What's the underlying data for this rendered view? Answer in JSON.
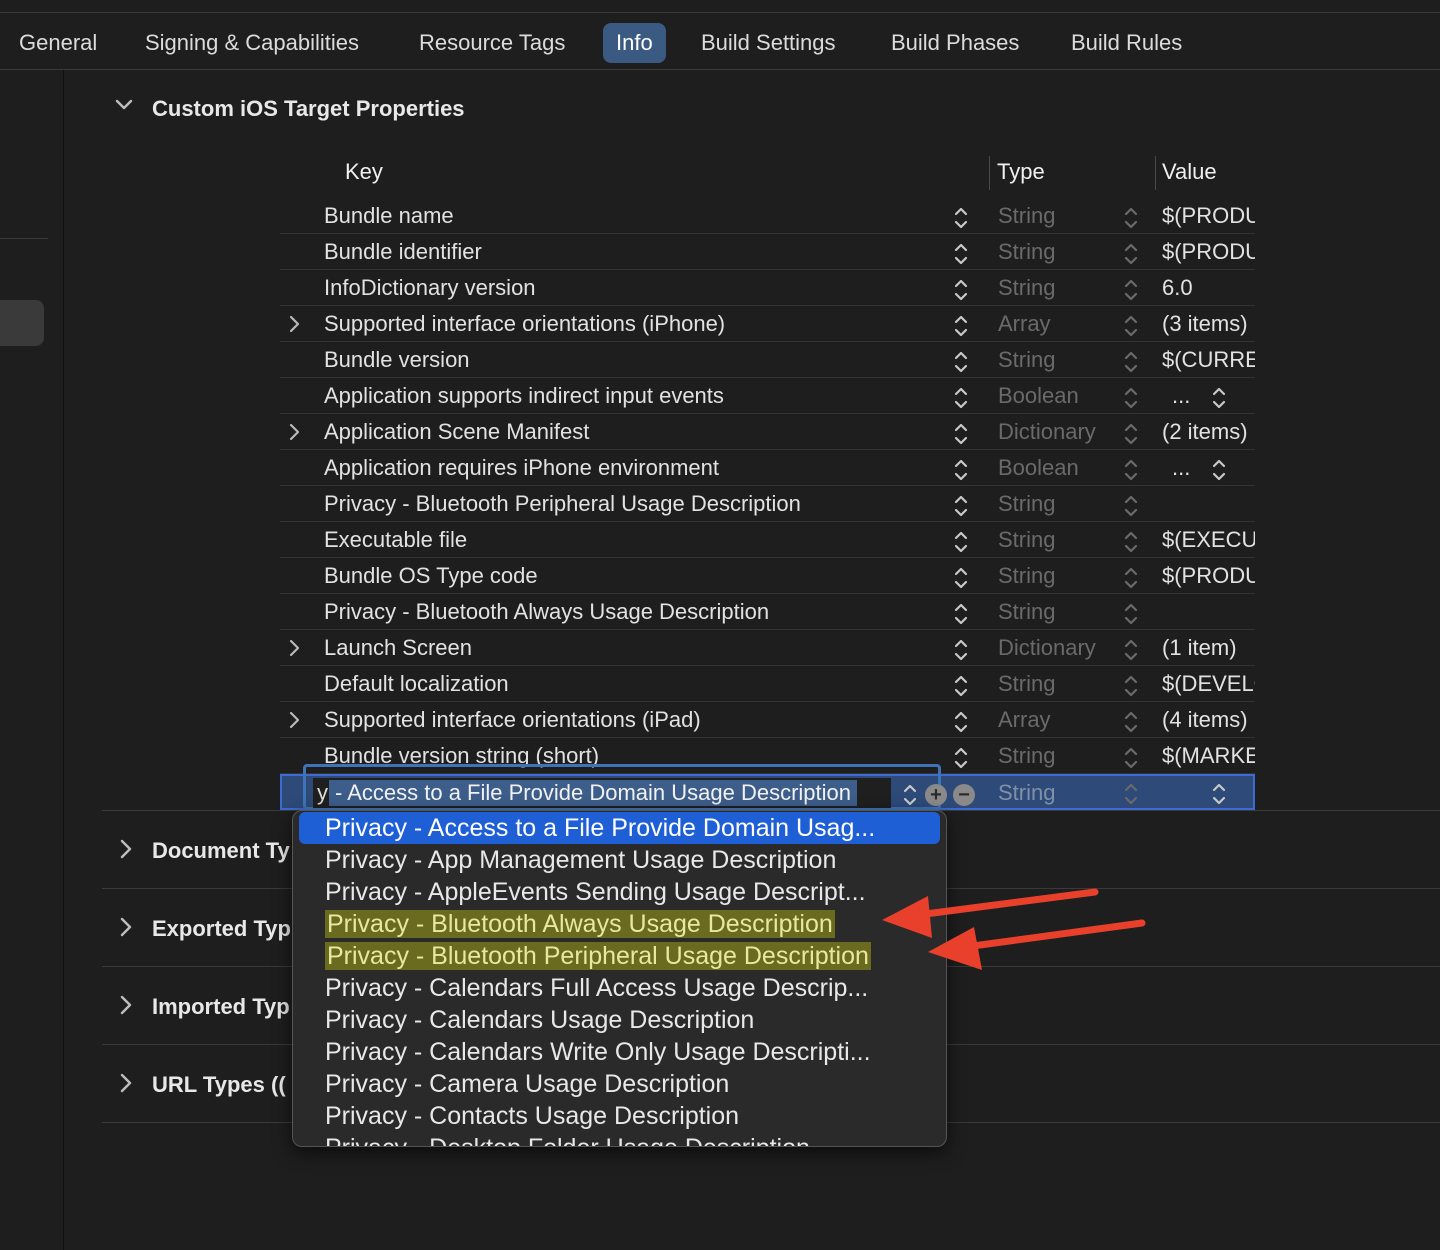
{
  "tabs": [
    {
      "label": "General"
    },
    {
      "label": "Signing & Capabilities"
    },
    {
      "label": "Resource Tags"
    },
    {
      "label": "Info"
    },
    {
      "label": "Build Settings"
    },
    {
      "label": "Build Phases"
    },
    {
      "label": "Build Rules"
    }
  ],
  "section": {
    "title": "Custom iOS Target Properties"
  },
  "columns": {
    "key": "Key",
    "type": "Type",
    "value": "Value"
  },
  "rows": [
    {
      "key": "Bundle name",
      "type": "String",
      "value": "$(PRODUCT_NAME)",
      "expandable": false
    },
    {
      "key": "Bundle identifier",
      "type": "String",
      "value": "$(PRODUCT_BUNDLE_IDENTIFIER)",
      "expandable": false
    },
    {
      "key": "InfoDictionary version",
      "type": "String",
      "value": "6.0",
      "expandable": false
    },
    {
      "key": "Supported interface orientations (iPhone)",
      "type": "Array",
      "value": "(3 items)",
      "expandable": true
    },
    {
      "key": "Bundle version",
      "type": "String",
      "value": "$(CURRENT_PROJECT_VERSION)",
      "expandable": false
    },
    {
      "key": "Application supports indirect input events",
      "type": "Boolean",
      "value": "...",
      "expandable": false
    },
    {
      "key": "Application Scene Manifest",
      "type": "Dictionary",
      "value": "(2 items)",
      "expandable": true
    },
    {
      "key": "Application requires iPhone environment",
      "type": "Boolean",
      "value": "...",
      "expandable": false
    },
    {
      "key": "Privacy - Bluetooth Peripheral Usage Description",
      "type": "String",
      "value": "",
      "expandable": false
    },
    {
      "key": "Executable file",
      "type": "String",
      "value": "$(EXECUTABLE_NAME)",
      "expandable": false
    },
    {
      "key": "Bundle OS Type code",
      "type": "String",
      "value": "$(PRODUCT_BUNDLE_PACKAGE_TYPE)",
      "expandable": false
    },
    {
      "key": "Privacy - Bluetooth Always Usage Description",
      "type": "String",
      "value": "",
      "expandable": false
    },
    {
      "key": "Launch Screen",
      "type": "Dictionary",
      "value": "(1 item)",
      "expandable": true
    },
    {
      "key": "Default localization",
      "type": "String",
      "value": "$(DEVELOPMENT_LANGUAGE)",
      "expandable": false
    },
    {
      "key": "Supported interface orientations (iPad)",
      "type": "Array",
      "value": "(4 items)",
      "expandable": true
    },
    {
      "key": "Bundle version string (short)",
      "type": "String",
      "value": "$(MARKETING_VERSION)",
      "expandable": false
    }
  ],
  "edit_row": {
    "caret_text": "y",
    "selected_text": "- Access to a File Provide Domain Usage Description",
    "type": "String",
    "add_symbol": "+",
    "remove_symbol": "−"
  },
  "collapsed_sections": [
    {
      "title": "Document Ty"
    },
    {
      "title": "Exported Typ"
    },
    {
      "title": "Imported Typ"
    },
    {
      "title": "URL Types (("
    }
  ],
  "dropdown": {
    "items": [
      {
        "label": "Privacy - Access to a File Provide Domain Usag...",
        "state": "selected"
      },
      {
        "label": "Privacy - App Management Usage Description",
        "state": "normal"
      },
      {
        "label": "Privacy - AppleEvents Sending Usage Descript...",
        "state": "normal"
      },
      {
        "label": "Privacy - Bluetooth Always Usage Description",
        "state": "highlighted"
      },
      {
        "label": "Privacy - Bluetooth Peripheral Usage Description",
        "state": "highlighted"
      },
      {
        "label": "Privacy - Calendars Full Access Usage Descrip...",
        "state": "normal"
      },
      {
        "label": "Privacy - Calendars Usage Description",
        "state": "normal"
      },
      {
        "label": "Privacy - Calendars Write Only Usage Descripti...",
        "state": "normal"
      },
      {
        "label": "Privacy - Camera Usage Description",
        "state": "normal"
      },
      {
        "label": "Privacy - Contacts Usage Description",
        "state": "normal"
      },
      {
        "label": "Privacy - Desktop Folder Usage Description",
        "state": "normal"
      }
    ]
  },
  "annotations": {
    "arrow_color": "#e8402a",
    "highlight_color": "#6b6b1f"
  }
}
